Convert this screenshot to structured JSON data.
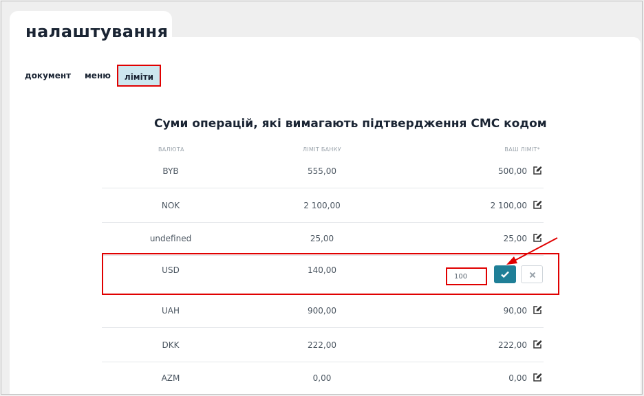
{
  "page": {
    "title": "налаштування"
  },
  "tabs": [
    {
      "label": "документ"
    },
    {
      "label": "меню"
    },
    {
      "label": "ліміти"
    }
  ],
  "section": {
    "title": "Суми операцій, які вимагають підтвердження СМС кодом"
  },
  "table": {
    "headers": {
      "currency": "ВАЛЮТА",
      "bank_limit": "ЛІМІТ БАНКУ",
      "your_limit": "ВАШ ЛІМІТ*"
    },
    "rows": [
      {
        "currency": "BYB",
        "bank_limit": "555,00",
        "your_limit": "500,00"
      },
      {
        "currency": "NOK",
        "bank_limit": "2 100,00",
        "your_limit": "2 100,00"
      },
      {
        "currency": "undefined",
        "bank_limit": "25,00",
        "your_limit": "25,00"
      },
      {
        "currency": "USD",
        "bank_limit": "140,00",
        "input_value": "100"
      },
      {
        "currency": "UAH",
        "bank_limit": "900,00",
        "your_limit": "90,00"
      },
      {
        "currency": "DKK",
        "bank_limit": "222,00",
        "your_limit": "222,00"
      },
      {
        "currency": "AZM",
        "bank_limit": "0,00",
        "your_limit": "0,00"
      }
    ]
  },
  "icons": {
    "edit": "edit-icon",
    "confirm": "check-icon",
    "cancel": "close-icon"
  },
  "colors": {
    "accent": "#1f7f97",
    "active_tab": "#cde7ef",
    "annotation": "#e00000",
    "text_dark": "#1a2433"
  }
}
